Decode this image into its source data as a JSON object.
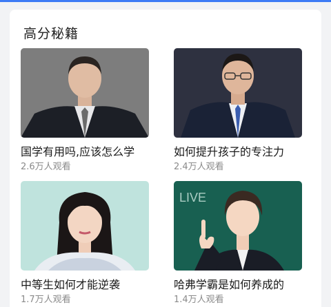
{
  "section": {
    "title": "高分秘籍"
  },
  "items": [
    {
      "title": "国学有用吗,应该怎么学",
      "views": "2.6万人观看",
      "image": "man-grey-suit-portrait"
    },
    {
      "title": "如何提升孩子的专注力",
      "views": "2.4万人观看",
      "image": "man-glasses-navy-suit-portrait"
    },
    {
      "title": "中等生如何才能逆袭",
      "views": "1.7万人观看",
      "image": "woman-teal-background-portrait"
    },
    {
      "title": "哈弗学霸是如何养成的",
      "views": "1.4万人观看",
      "image": "man-pointing-green-background",
      "badge": "LIVE"
    }
  ]
}
